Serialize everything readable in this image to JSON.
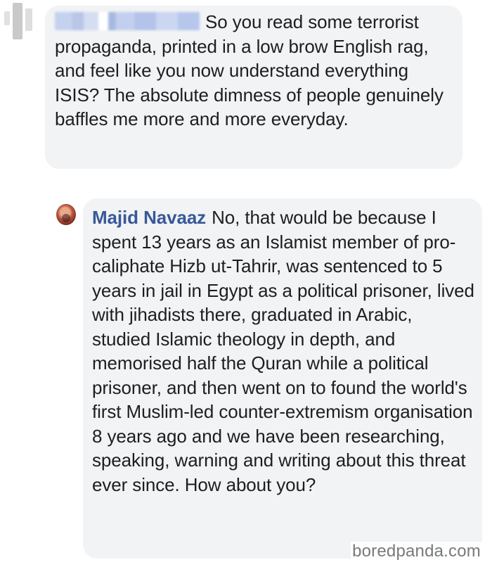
{
  "comment": {
    "author_blurred": true,
    "text": "So you read some terrorist propaganda, printed in a low brow English rag, and feel like you now understand everything ISIS? The absolute dimness of people genuinely baffles me more and more everyday."
  },
  "reply": {
    "author": "Majid Navaaz",
    "text": "No, that would be because I spent 13 years as an Islamist member of pro-caliphate Hizb ut-Tahrir, was sentenced to 5 years in jail in Egypt as a political prisoner, lived with jihadists there, graduated in Arabic, studied Islamic theology in depth, and memorised half the Quran while a political prisoner, and then went on to found the world's first Muslim-led counter-extremism organisation 8 years ago and we have been researching, speaking, warning and writing about this threat ever since. How about you?"
  },
  "watermark": "boredpanda.com",
  "colors": {
    "bubble_bg": "#f2f3f5",
    "author_link": "#385898",
    "text": "#1c1e21"
  }
}
